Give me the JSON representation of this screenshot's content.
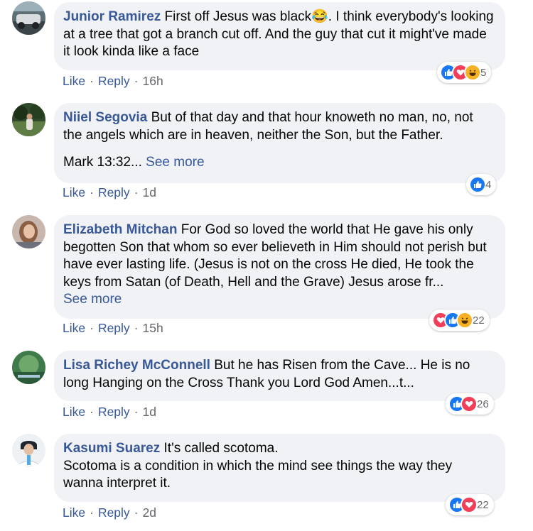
{
  "comments": [
    {
      "author": "Junior Ramirez",
      "text": "First off Jesus was black😂. I think everybody's looking at a tree that got a branch cut off. And the guy that cut it might've made it look kinda like a face",
      "actions": {
        "like": "Like",
        "reply": "Reply",
        "time": "16h"
      },
      "reactions": {
        "types": [
          "like",
          "love",
          "haha"
        ],
        "count": "5"
      }
    },
    {
      "author": "Niiel Segovia",
      "text": "But of that day and that hour knoweth no man, no, not the angels which are in heaven, neither the Son, but the Father.",
      "text2": "Mark 13:32...",
      "see_more": "See more",
      "actions": {
        "like": "Like",
        "reply": "Reply",
        "time": "1d"
      },
      "reactions": {
        "types": [
          "like"
        ],
        "count": "4"
      }
    },
    {
      "author": "Elizabeth Mitchan",
      "text": "For God so loved the world that He gave his only begotten Son that whom so ever believeth in Him should not perish but have ever lasting life. (Jesus is not on the cross He died, He took the keys from Satan (of Death, Hell and the Grave) Jesus arose fr...",
      "see_more": "See more",
      "actions": {
        "like": "Like",
        "reply": "Reply",
        "time": "15h"
      },
      "reactions": {
        "types": [
          "love",
          "like",
          "haha"
        ],
        "count": "22"
      }
    },
    {
      "author": "Lisa Richey McConnell",
      "text": "But he has Risen from the Cave... He is no long Hanging on the Cross Thank you Lord God Amen...t...",
      "actions": {
        "like": "Like",
        "reply": "Reply",
        "time": "1d"
      },
      "reactions": {
        "types": [
          "like",
          "love"
        ],
        "count": "26"
      }
    },
    {
      "author": "Kasumi Suarez",
      "text": "It's called scotoma.",
      "text2": "Scotoma is a condition in which the mind see things the way they wanna interpret it.",
      "actions": {
        "like": "Like",
        "reply": "Reply",
        "time": "2d"
      },
      "reactions": {
        "types": [
          "like",
          "love"
        ],
        "count": "22"
      }
    }
  ],
  "icons": {
    "like": "thumbs-up-icon",
    "love": "heart-icon",
    "haha": "laughing-face-icon"
  },
  "colors": {
    "name": "#385898",
    "bubble": "#f0f2f5",
    "like": "#1877f2",
    "love": "#f33e58",
    "haha": "#f7b125",
    "meta": "#65676b"
  },
  "separator": "·"
}
